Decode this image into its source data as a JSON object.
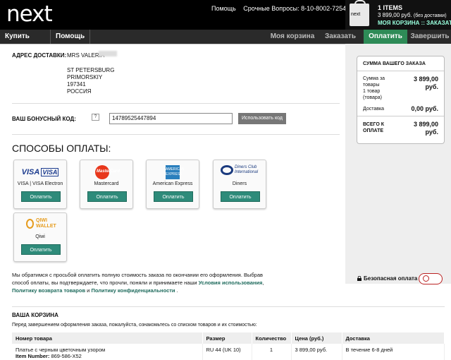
{
  "header": {
    "logo": "next",
    "links": [
      "Помощь",
      "Срочные Вопросы: 8-10-8002-7254011"
    ],
    "cart": {
      "bag_label": "next",
      "items": "1 ITEMS",
      "total": "3 899,00 руб.",
      "total_note": "(без доставки)",
      "link": "МОЯ КОРЗИНА :: ЗАКАЗАТЬ"
    }
  },
  "nav": {
    "buttons": [
      "Купить еще",
      "Помощь"
    ],
    "steps": [
      "Моя корзина",
      "Заказать",
      "Оплатить",
      "Завершить"
    ],
    "active_step": "Оплатить"
  },
  "address": {
    "label": "АДРЕС ДОСТАВКИ:",
    "name": "MRS VALERIA",
    "lines": [
      "ST PETERSBURG",
      "PRIMORSKIY",
      "197341",
      "РОССИЯ"
    ]
  },
  "bonus": {
    "label": "ВАШ БОНУСНЫЙ КОД:",
    "help": "?",
    "value": "14789525447894",
    "button": "Использовать код"
  },
  "payment": {
    "heading": "СПОСОБЫ ОПЛАТЫ:",
    "methods": [
      {
        "name": "VISA | VISA Electron",
        "logo": "VISA",
        "logo2": "VISA",
        "button": "Оплатить"
      },
      {
        "name": "Mastercard",
        "logo": "MasterCard",
        "button": "Оплатить"
      },
      {
        "name": "American Express",
        "logo": "AMERICAN EXPRESS",
        "button": "Оплатить"
      },
      {
        "name": "Diners",
        "logo": "Diners Club International",
        "button": "Оплатить"
      },
      {
        "name": "Qiwi",
        "logo": "QIWI WALLET",
        "button": "Оплатить"
      }
    ]
  },
  "legal": {
    "text1": "Мы обратимся с просьбой оплатить полную стоимость заказа по окончании его оформления. Выбрав способ оплаты, вы подтверждаете, что прочли, поняли и принимаете наши ",
    "link1": "Условия использования",
    "sep1": ", ",
    "link2": "Политику возврата товаров",
    "sep2": " и ",
    "link3": "Политику конфиденциальности",
    "end": " ."
  },
  "summary": {
    "title": "СУММА ВАШЕГО ЗАКАЗА",
    "goods_label": "Сумма за товары",
    "goods_sub": "1 товар (товара)",
    "goods_value": "3 899,00 руб.",
    "delivery_label": "Доставка",
    "delivery_value": "0,00 руб.",
    "total_label": "ВСЕГО К ОПЛАТЕ",
    "total_value": "3 899,00 руб."
  },
  "secure": {
    "label": "Безопасная оплата"
  },
  "cart": {
    "title": "ВАША КОРЗИНА",
    "note": "Перед завершением оформления заказа, пожалуйста, ознакомьтесь со списком товаров и их стоимостью:",
    "columns": [
      "Номер товара",
      "Размер",
      "Количество",
      "Цена (руб.)",
      "Доставка"
    ],
    "row": {
      "name": "Платье с черным цветочным узором",
      "item_number_label": "Item Number:",
      "item_number": "869-586-X52",
      "size": "RU 44 (UK 10)",
      "qty": "1",
      "price": "3 899,00 руб.",
      "delivery": "В течение 6-8 дней"
    }
  }
}
